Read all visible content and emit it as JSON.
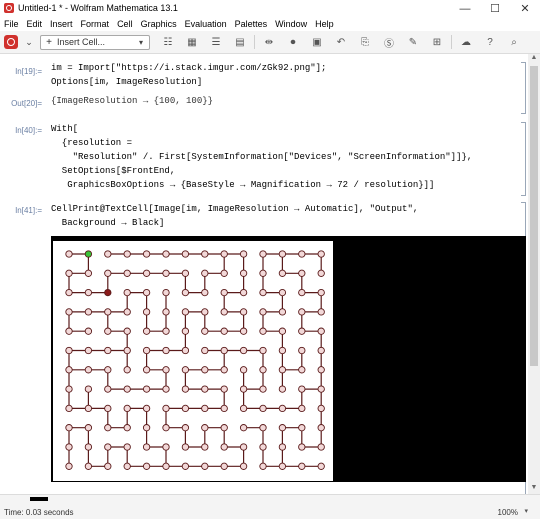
{
  "window": {
    "title": "Untitled-1 * - Wolfram Mathematica 13.1",
    "min": "—",
    "max": "☐",
    "close": "✕"
  },
  "menu": [
    "File",
    "Edit",
    "Insert",
    "Format",
    "Cell",
    "Graphics",
    "Evaluation",
    "Palettes",
    "Window",
    "Help"
  ],
  "toolbar": {
    "insert_cell_label": "Insert Cell...",
    "plus": "+",
    "chevron": "⌄"
  },
  "cells": {
    "in19_label": "In[19]:=",
    "in19_line1": "im = Import[\"https://i.stack.imgur.com/zGk92.png\"];",
    "in19_line2": "Options[im, ImageResolution]",
    "out20_label": "Out[20]=",
    "out20_text": "{ImageResolution → {100, 100}}",
    "in40_label": "In[40]:=",
    "in40_line1": "With[",
    "in40_line2": "  {resolution =",
    "in40_line3": "    \"Resolution\" /. First[SystemInformation[\"Devices\", \"ScreenInformation\"]]},",
    "in40_line4": "  SetOptions[$FrontEnd,",
    "in40_line5": "   GraphicsBoxOptions → {BaseStyle → Magnification → 72 / resolution}]]",
    "in41_label": "In[41]:=",
    "in41_line1": "CellPrint@TextCell[Image[im, ImageResolution → Automatic], \"Output\",",
    "in41_line2": "  Background → Black]"
  },
  "status": {
    "time": "Time: 0.03 seconds",
    "zoom": "100%"
  },
  "colors": {
    "maze_node_fill": "#f2d8d8",
    "maze_line": "#5a1a1a",
    "start_node": "#39c439",
    "end_node": "#8b1a1a"
  }
}
